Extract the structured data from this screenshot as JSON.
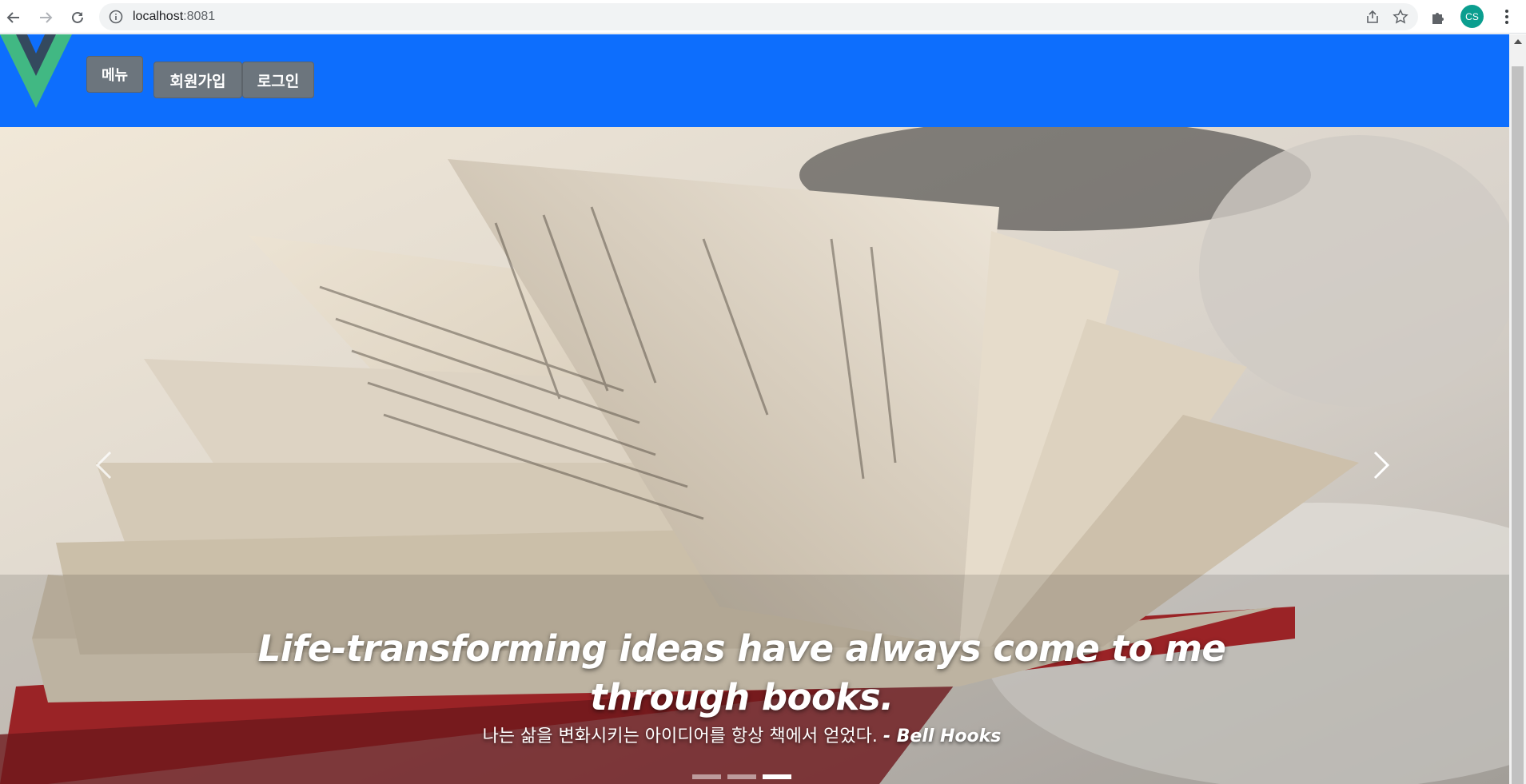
{
  "browser": {
    "url_host": "localhost",
    "url_port": ":8081",
    "profile_initials": "CS",
    "profile_color": "#0b9e8f"
  },
  "header": {
    "background_color": "#0d6efd",
    "menu_label": "메뉴",
    "signup_label": "회원가입",
    "login_label": "로그인",
    "button_color": "#6c757d"
  },
  "carousel": {
    "quote": "Life-transforming ideas have always come to me through books.",
    "translation": "나는 삶을 변화시키는 아이디어를 항상 책에서 얻었다.",
    "author": "- Bell Hooks",
    "slide_count": 3,
    "active_slide": 3,
    "prev_icon": "chevron-left-icon",
    "next_icon": "chevron-right-icon"
  }
}
